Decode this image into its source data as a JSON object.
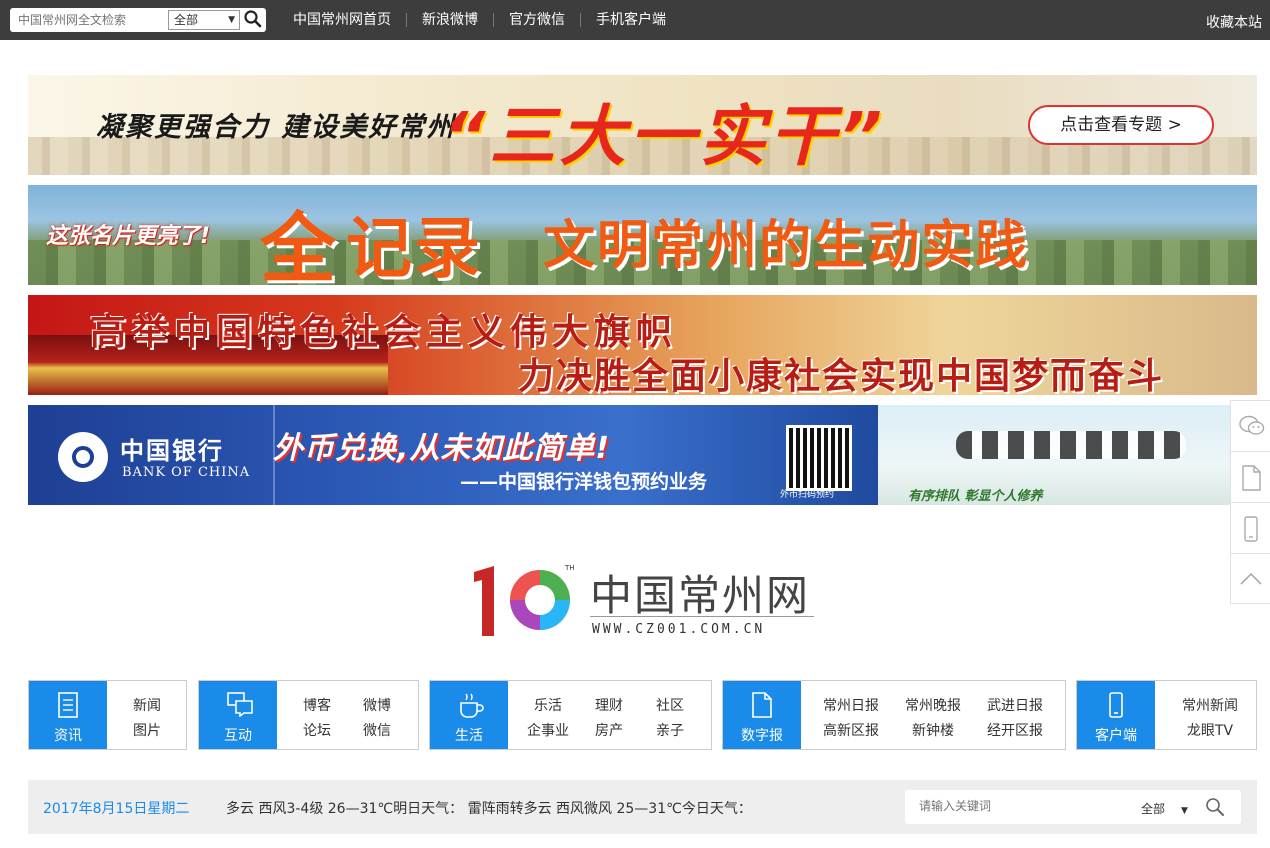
{
  "topbar": {
    "search_placeholder": "中国常州网全文检索",
    "scope": "全部",
    "nav": [
      "中国常州网首页",
      "新浪微博",
      "官方微信",
      "手机客户端"
    ],
    "favorite": "收藏本站"
  },
  "banners": {
    "b1": {
      "slogan": "凝聚更强合力 建设美好常州",
      "headline": "“三大一实干”",
      "button": "点击查看专题 >"
    },
    "b2": {
      "small": "这张名片更亮了!",
      "quan": "全",
      "ji": "记录",
      "rest": "文明常州的生动实践"
    },
    "b3": {
      "line1": "高举中国特色社会主义伟大旗帜",
      "line2": "力决胜全面小康社会实现中国梦而奋斗"
    },
    "b4": {
      "bank": "中国银行",
      "bank_en": "BANK OF CHINA",
      "slogan": "外币兑换,从未如此简单!",
      "sub": "——中国银行洋钱包预约业务",
      "qr_caption": "外币扫码预约",
      "right_slogan": "有序排队 彰显个人修养"
    }
  },
  "logo": {
    "name": "中国常州网",
    "url": "WWW.CZ001.COM.CN",
    "tm": "TH",
    "colors": {
      "ten": "#c62828",
      "ring_a": "#f5a623",
      "ring_b": "#4caf50",
      "ring_c": "#29b6f6",
      "ring_d": "#ab47bc",
      "ring_e": "#ef5350"
    }
  },
  "categories": [
    {
      "label": "资讯",
      "icon": "document-icon",
      "links": [
        "新闻",
        "图片"
      ]
    },
    {
      "label": "互动",
      "icon": "chat-icon",
      "links": [
        "博客",
        "微博",
        "论坛",
        "微信"
      ]
    },
    {
      "label": "生活",
      "icon": "coffee-icon",
      "links": [
        "乐活",
        "理财",
        "社区",
        "企事业",
        "房产",
        "亲子"
      ]
    },
    {
      "label": "数字报",
      "icon": "paper-icon",
      "links": [
        "常州日报",
        "常州晚报",
        "武进日报",
        "高新区报",
        "新钟楼",
        "经开区报"
      ]
    },
    {
      "label": "客户端",
      "icon": "mobile-icon",
      "links": [
        "常州新闻",
        "龙眼TV"
      ]
    }
  ],
  "weather": {
    "date": "2017年8月15日星期二",
    "text": "多云 西风3-4级 26—31℃明日天气： 雷阵雨转多云 西风微风 25—31℃今日天气：",
    "search_placeholder": "请输入关键词",
    "scope": "全部"
  },
  "colors": {
    "accent": "#1a8be8",
    "topbar": "#3d3d3d"
  }
}
